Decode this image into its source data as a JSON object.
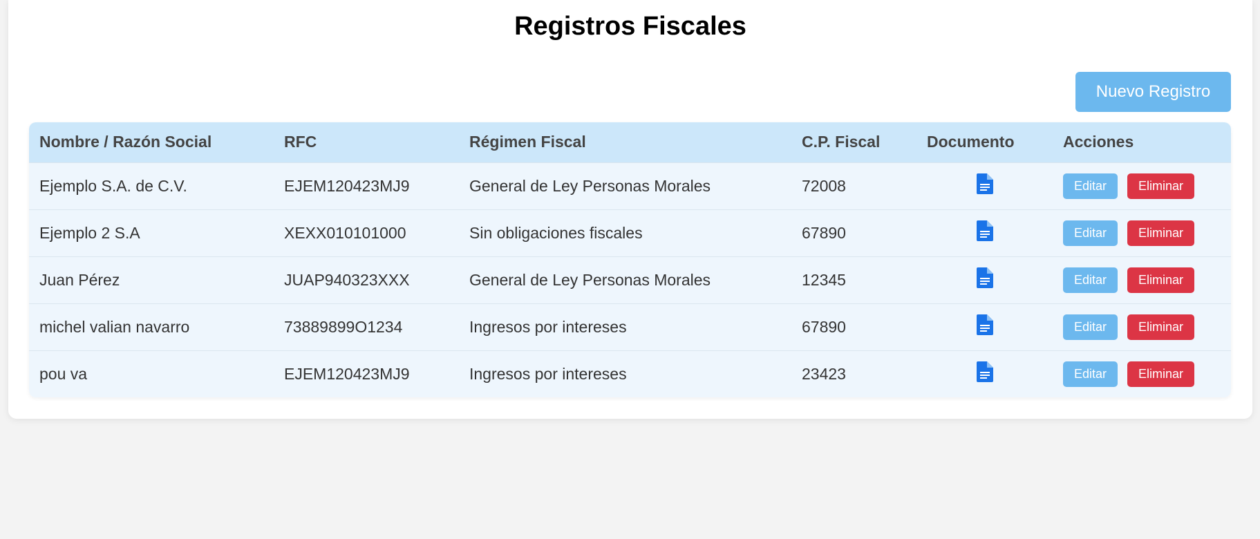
{
  "page": {
    "title": "Registros Fiscales",
    "new_button_label": "Nuevo Registro"
  },
  "table": {
    "headers": [
      "Nombre / Razón Social",
      "RFC",
      "Régimen Fiscal",
      "C.P. Fiscal",
      "Documento",
      "Acciones"
    ],
    "edit_label": "Editar",
    "delete_label": "Eliminar",
    "document_icon": "document-icon",
    "rows": [
      {
        "nombre": "Ejemplo S.A. de C.V.",
        "rfc": "EJEM120423MJ9",
        "regimen": "General de Ley Personas Morales",
        "cp": "72008"
      },
      {
        "nombre": "Ejemplo 2 S.A",
        "rfc": "XEXX010101000",
        "regimen": "Sin obligaciones fiscales",
        "cp": "67890"
      },
      {
        "nombre": "Juan Pérez",
        "rfc": "JUAP940323XXX",
        "regimen": "General de Ley Personas Morales",
        "cp": "12345"
      },
      {
        "nombre": "michel valian navarro",
        "rfc": "73889899O1234",
        "regimen": "Ingresos por intereses",
        "cp": "67890"
      },
      {
        "nombre": "pou va",
        "rfc": "EJEM120423MJ9",
        "regimen": "Ingresos por intereses",
        "cp": "23423"
      }
    ]
  },
  "colors": {
    "accent": "#6cb8ee",
    "danger": "#dc3545",
    "header_bg": "#cce7fa",
    "row_bg": "#eef6fd",
    "doc_icon": "#1a73e8"
  }
}
